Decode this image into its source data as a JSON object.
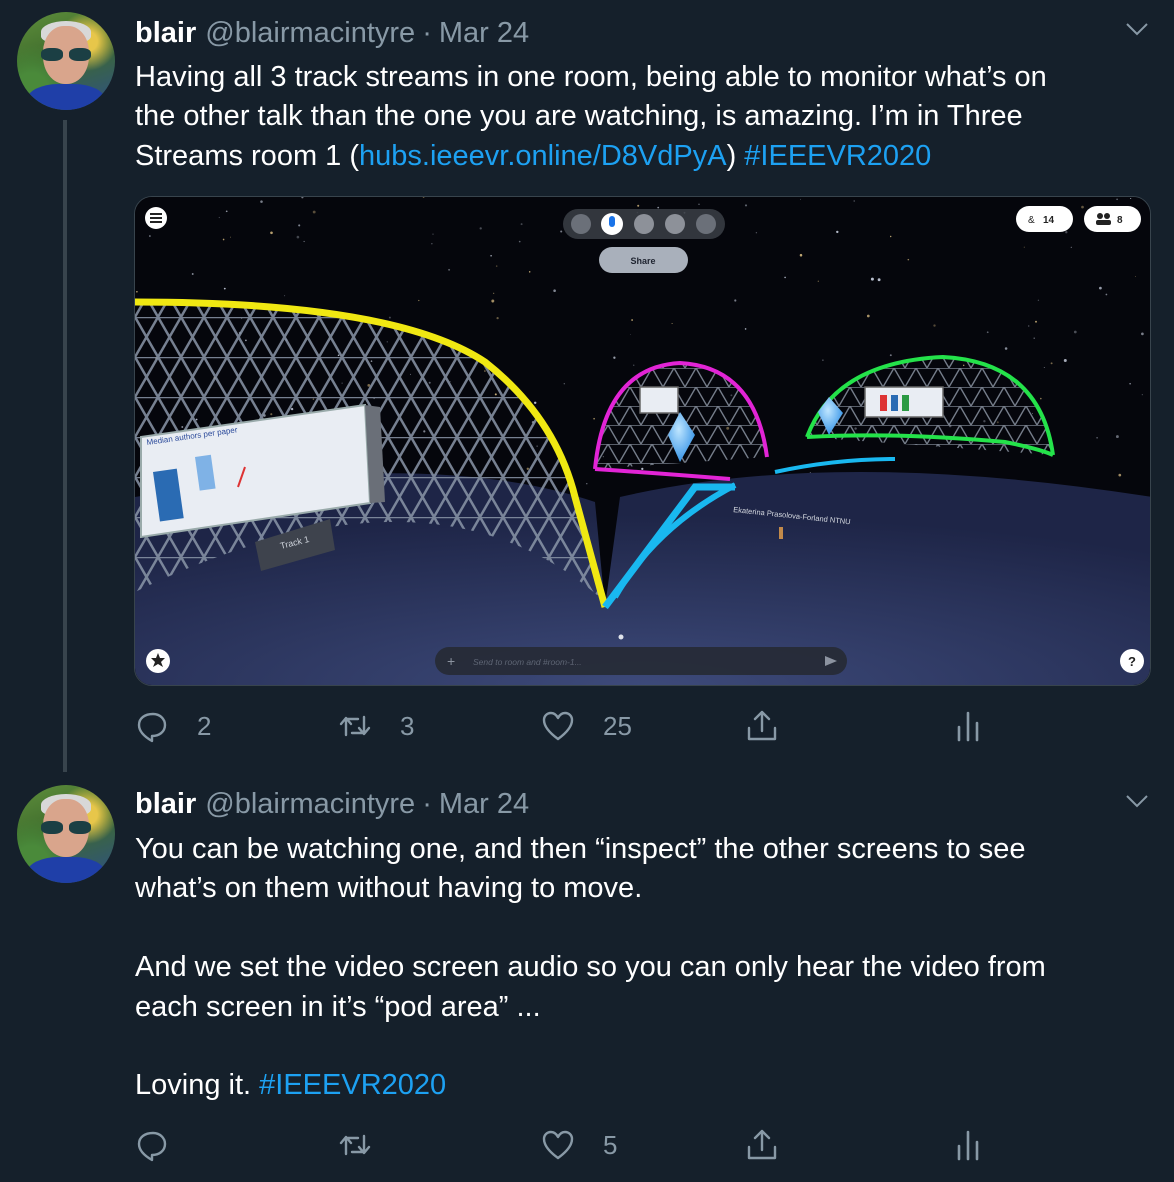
{
  "tweets": [
    {
      "name": "blair",
      "handle": "@blairmacintyre",
      "separator": "·",
      "date": "Mar 24",
      "text_lines": [
        [
          {
            "t": "Having all 3 track streams in one room, being able to monitor what’s on"
          }
        ],
        [
          {
            "t": "the other talk than the one you are watching, is amazing.  I’m in Three"
          }
        ],
        [
          {
            "t": "Streams room 1 ("
          },
          {
            "t": "hubs.ieeevr.online/D8VdPyA",
            "link": true
          },
          {
            "t": ")   "
          },
          {
            "t": "#IEEEVR2020",
            "link": true
          }
        ]
      ],
      "media": {
        "room_count": "14",
        "people_count": "8",
        "share_label": "Share",
        "track_sign": "Track 1",
        "slide_title": "Median authors per paper",
        "nametag": "Ekaterina Prasolova-Forland NTNU",
        "chat_placeholder": "Send to room and #room-1...",
        "help_label": "?"
      },
      "stats": {
        "replies": "2",
        "retweets": "3",
        "likes": "25"
      }
    },
    {
      "name": "blair",
      "handle": "@blairmacintyre",
      "separator": "·",
      "date": "Mar 24",
      "text_lines": [
        [
          {
            "t": "You can be watching one, and then “inspect” the other screens to see"
          }
        ],
        [
          {
            "t": "what’s on them without having to move."
          }
        ],
        [],
        [
          {
            "t": "And we set the video screen audio so you can only hear the video from"
          }
        ],
        [
          {
            "t": "each screen in it’s “pod area” ..."
          }
        ],
        [],
        [
          {
            "t": "Loving it. "
          },
          {
            "t": "#IEEEVR2020",
            "link": true
          }
        ]
      ],
      "stats": {
        "replies": "",
        "retweets": "",
        "likes": "5"
      }
    }
  ],
  "icons": {
    "reply": "reply-icon",
    "retweet": "retweet-icon",
    "like": "heart-icon",
    "share": "share-icon",
    "stats": "analytics-icon",
    "more": "chevron-down-icon"
  },
  "colors": {
    "background": "#15202b",
    "secondary_text": "#8899a6",
    "link": "#1da1f2",
    "thread_line": "#38444d"
  }
}
